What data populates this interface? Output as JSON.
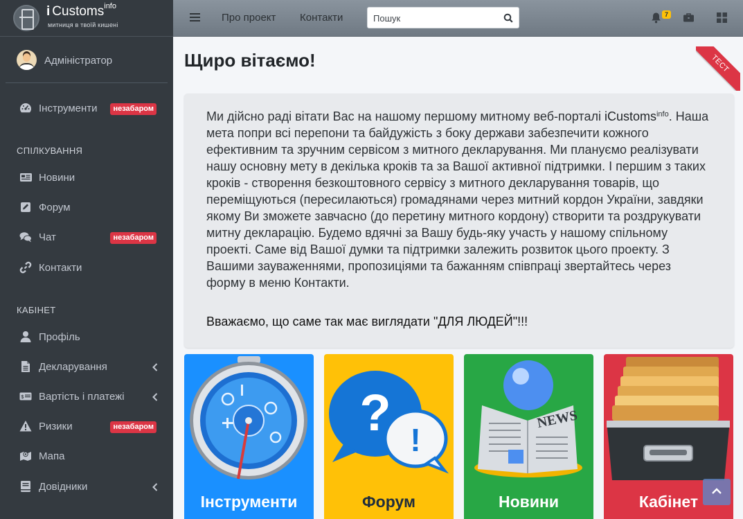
{
  "brand": {
    "prefix": "i",
    "name": "Customs",
    "sup": "info",
    "tagline": "митниця в твоїй кишені"
  },
  "user": {
    "name": "Адміністратор"
  },
  "sidebar": {
    "tools": {
      "label": "Інструменти",
      "badge": "незабаром"
    },
    "sections": [
      {
        "title": "СПІЛКУВАННЯ",
        "items": [
          {
            "label": "Новини",
            "icon": "newspaper-icon"
          },
          {
            "label": "Форум",
            "icon": "edit-icon"
          },
          {
            "label": "Чат",
            "icon": "comments-icon",
            "badge": "незабаром"
          },
          {
            "label": "Контакти",
            "icon": "link-icon"
          }
        ]
      },
      {
        "title": "КАБІНЕТ",
        "items": [
          {
            "label": "Профіль",
            "icon": "user-icon"
          },
          {
            "label": "Декларування",
            "icon": "file-icon",
            "expandable": true
          },
          {
            "label": "Вартість і платежі",
            "icon": "money-icon",
            "expandable": true
          },
          {
            "label": "Ризики",
            "icon": "warning-icon",
            "badge": "незабаром"
          },
          {
            "label": "Мапа",
            "icon": "map-icon"
          },
          {
            "label": "Довідники",
            "icon": "book-icon",
            "expandable": true
          }
        ]
      }
    ]
  },
  "topbar": {
    "links": [
      "Про проект",
      "Контакти"
    ],
    "search_placeholder": "Пошук",
    "notifications_count": "7"
  },
  "main": {
    "title": "Щиро вітаємо!",
    "ribbon": "ТЕСТ",
    "welcome": {
      "p1_before": "Ми дійсно раді вітати Вас на нашому першому митному веб-порталі ",
      "p1_brand": "iCustoms",
      "p1_sup": "info",
      "p1_after": ". Наша мета попри всі перепони та байдужість з боку держави забезпечити кожного ефективним та зручним сервісом з митного декларування. Ми плануємо реалізувати нашу основну мету в декілька кроків та за Вашої активної підтримки. І першим з таких кроків - створення безкоштовного сервісу з митного декларування товарів, що переміщуються (пересилаються) громадянами через митний кордон України, завдяки якому Ви зможете завчасно (до перетину митного кордону) створити та роздрукувати митну декларацію. Будемо вдячні за Вашу будь-яку участь у нашому спільному проекті. Саме від Вашої думки та підтримки залежить розвиток цього проекту. З Вашими зауваженнями, пропозиціями та бажанням співпраці звертайтесь через форму в меню Контакти.",
      "closing": "Вважаємо, що саме так має виглядати \"ДЛЯ ЛЮДЕЙ\"!!!"
    },
    "tiles": [
      {
        "label": "Інструменти",
        "color": "#1a90ff",
        "text_color": "#ffffff"
      },
      {
        "label": "Форум",
        "color": "#ffc107",
        "text_color": "#1f2d3d"
      },
      {
        "label": "Новини",
        "color": "#28a745",
        "text_color": "#ffffff"
      },
      {
        "label": "Кабінет",
        "color": "#dc3545",
        "text_color": "#ffffff"
      }
    ]
  },
  "colors": {
    "sidebar_bg": "#343a40",
    "badge": "#dc3545",
    "topbar": "#7b858f"
  }
}
